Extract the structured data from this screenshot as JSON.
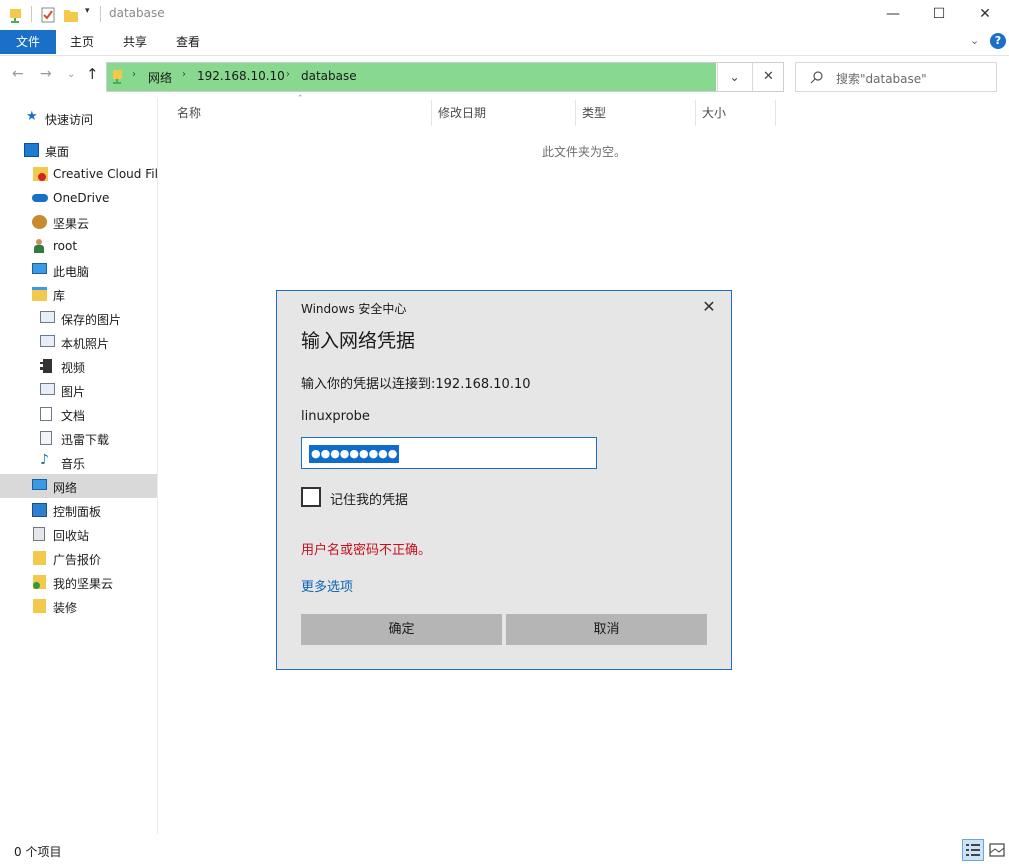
{
  "window": {
    "title": "database"
  },
  "ribbon": {
    "tabs": [
      "文件",
      "主页",
      "共享",
      "查看"
    ]
  },
  "address": {
    "crumbs": [
      "网络",
      "192.168.10.10",
      "database"
    ]
  },
  "search": {
    "placeholder": "搜索\"database\""
  },
  "sidebar": {
    "items": [
      {
        "label": "快速访问",
        "icon": "star-icon"
      },
      {
        "label": "桌面",
        "icon": "desktop-icon"
      },
      {
        "label": "Creative Cloud Files",
        "icon": "creative-cloud-folder-icon"
      },
      {
        "label": "OneDrive",
        "icon": "cloud-icon"
      },
      {
        "label": "坚果云",
        "icon": "nut-icon"
      },
      {
        "label": "root",
        "icon": "user-icon"
      },
      {
        "label": "此电脑",
        "icon": "computer-icon"
      },
      {
        "label": "库",
        "icon": "library-icon"
      },
      {
        "label": "保存的图片",
        "icon": "pictures-library-icon"
      },
      {
        "label": "本机照片",
        "icon": "photos-library-icon"
      },
      {
        "label": "视频",
        "icon": "video-library-icon"
      },
      {
        "label": "图片",
        "icon": "image-library-icon"
      },
      {
        "label": "文档",
        "icon": "documents-library-icon"
      },
      {
        "label": "迅雷下载",
        "icon": "download-library-icon"
      },
      {
        "label": "音乐",
        "icon": "music-icon"
      },
      {
        "label": "网络",
        "icon": "network-icon",
        "selected": true
      },
      {
        "label": "控制面板",
        "icon": "control-panel-icon"
      },
      {
        "label": "回收站",
        "icon": "recycle-bin-icon"
      },
      {
        "label": "广告报价",
        "icon": "folder-icon"
      },
      {
        "label": "我的坚果云",
        "icon": "synced-folder-icon"
      },
      {
        "label": "装修",
        "icon": "folder-icon"
      }
    ]
  },
  "content": {
    "columns": [
      "名称",
      "修改日期",
      "类型",
      "大小"
    ],
    "empty_message": "此文件夹为空。"
  },
  "status": {
    "item_count": "0 个项目"
  },
  "dialog": {
    "caption": "Windows 安全中心",
    "heading": "输入网络凭据",
    "prompt": "输入你的凭据以连接到:192.168.10.10",
    "username": "linuxprobe",
    "password_mask": "●●●●●●●●●",
    "remember_label": "记住我的凭据",
    "remember_checked": false,
    "error": "用户名或密码不正确。",
    "more_options": "更多选项",
    "ok_label": "确定",
    "cancel_label": "取消"
  },
  "colors": {
    "accent": "#1a6fc7",
    "address_highlight": "#88d88f",
    "error": "#c50f1f",
    "link": "#0a64b8"
  }
}
